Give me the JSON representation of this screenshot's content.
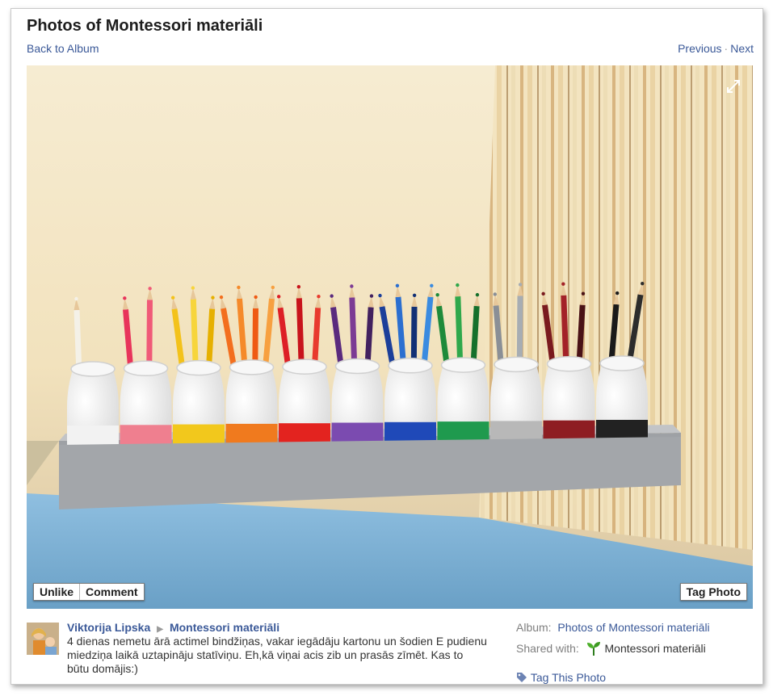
{
  "header": {
    "title": "Photos of Montessori materiāli",
    "back_label": "Back to Album",
    "previous_label": "Previous",
    "separator": "·",
    "next_label": "Next"
  },
  "photo_actions": {
    "unlike_label": "Unlike",
    "comment_label": "Comment",
    "tag_photo_label": "Tag Photo"
  },
  "post": {
    "author": "Viktorija Lipska",
    "album_link": "Montessori materiāli",
    "caption": "4 dienas nemetu ārā actimel bindžiņas, vakar iegādāju kartonu un šodien E pudienu miedziņa laikā uztapināju statīviņu. Eh,kā viņai acis zib un prasās zīmēt. Kas to būtu domājis:)"
  },
  "sidebar": {
    "album_label": "Album:",
    "album_value": "Photos of Montessori materiāli",
    "shared_label": "Shared with:",
    "shared_value": "Montessori materiāli",
    "tag_this_label": "Tag This Photo"
  },
  "icons": {
    "expand": "expand-icon",
    "arrow": "right-triangle-icon",
    "plant": "seedling-icon",
    "tag": "tag-icon"
  },
  "colors": {
    "link": "#3b5998",
    "wall": "#f3e5c4",
    "table": "#7fb3d6"
  }
}
